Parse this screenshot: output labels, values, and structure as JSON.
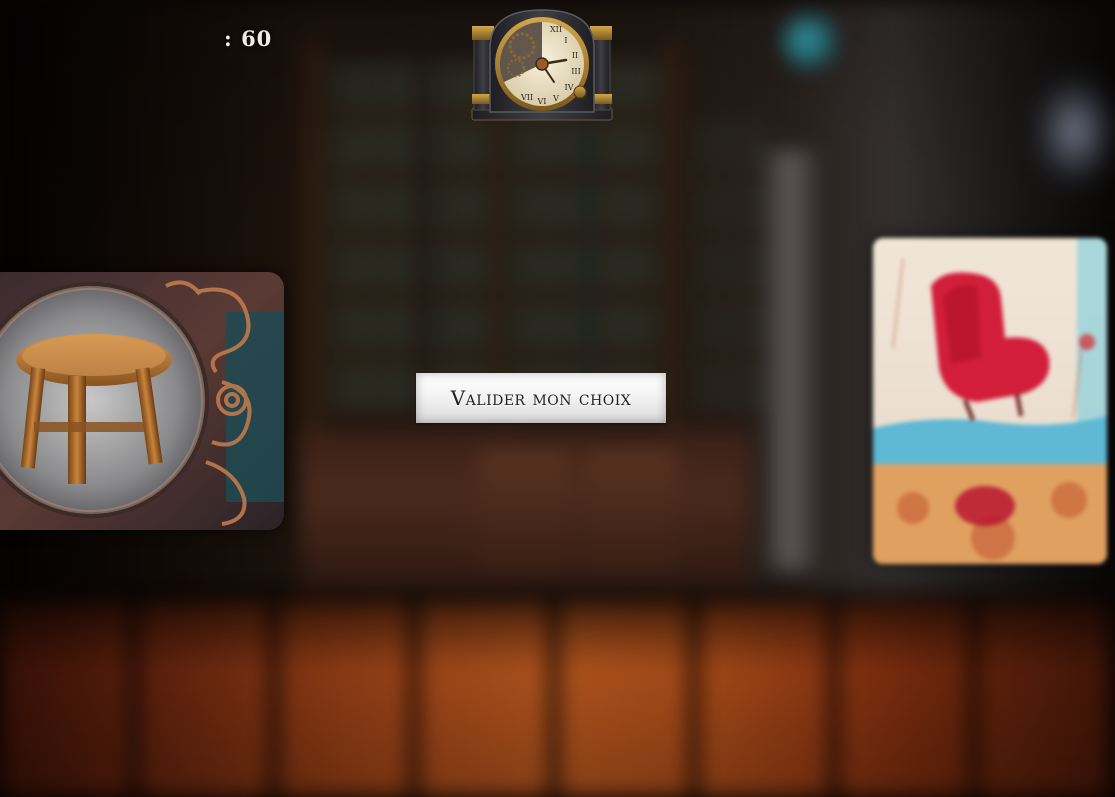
{
  "hud": {
    "timer_text": ": 60",
    "clock_icon": "antique-clock-icon"
  },
  "actions": {
    "validate_label": "Valider mon choix"
  },
  "cards": [
    {
      "image": "wooden-stool-card",
      "state": "active"
    },
    {
      "image": "red-chair-card",
      "state": "blurred"
    }
  ],
  "colors": {
    "timer_text": "#f2ece4",
    "button_bg": "#f4f4f4",
    "button_text": "#222222",
    "floor": "#a04317"
  }
}
